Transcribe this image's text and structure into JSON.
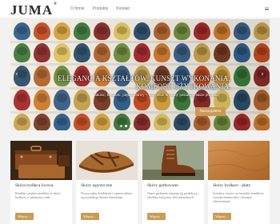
{
  "header": {
    "logo": "JUMA",
    "logo_mark": "®",
    "nav": [
      "O firmie",
      "Produkty",
      "Kontakt"
    ],
    "language_flag": "flag-icon-pl"
  },
  "hero": {
    "title_line1": "ELEGANCJA KSZTAŁTÓW, KUNSZT WYKONANIA,",
    "title_line2": "KOMFORT UŻYTKOWANIA.",
    "subtitle": "Jakość, trwałość, piękno barwy – wszystkie te cechy posiadają nasze produkty",
    "button": "Nasza galeria",
    "slides_count": 3,
    "active_slide": 1,
    "shoe_colors": [
      "#2f5e8c",
      "#c84a1e",
      "#d9a33b",
      "#3d7a3a",
      "#8c2a2a",
      "#e3c45a",
      "#2c4f6b",
      "#b5642b",
      "#6f8f3c",
      "#a8282a",
      "#d17a2a",
      "#385f8a",
      "#c9a34a",
      "#7b3b22"
    ]
  },
  "cards": [
    {
      "title": "Skóra bydlęca licowa",
      "text": "Rzadkie i piękne produkty ze skóry bydlęcej w najlepszej cenie.",
      "button": "Więcej ...",
      "image": "vintage-leather-suitcases-image"
    },
    {
      "title": "Skóry egzotyczne",
      "text": "Na początku działalności zajmowaliśmy się produkcją obuwia damskiego.",
      "button": "Więcej ...",
      "image": "leather-sandal-image"
    },
    {
      "title": "Skóry garbowane",
      "text": "Nasza garbarnia zajmuje się produkcją i obróbką wyłącznie skór naturalnych.",
      "button": "Więcej ...",
      "image": "leather-boot-image"
    },
    {
      "title": "Skóry bydlęce - płaty",
      "text": "Jesteśmy otwarci na kontakty handlowe z producentami skór i firmami chemicznymi.",
      "button": "Więcej ...",
      "image": "leather-hide-texture-image"
    }
  ]
}
